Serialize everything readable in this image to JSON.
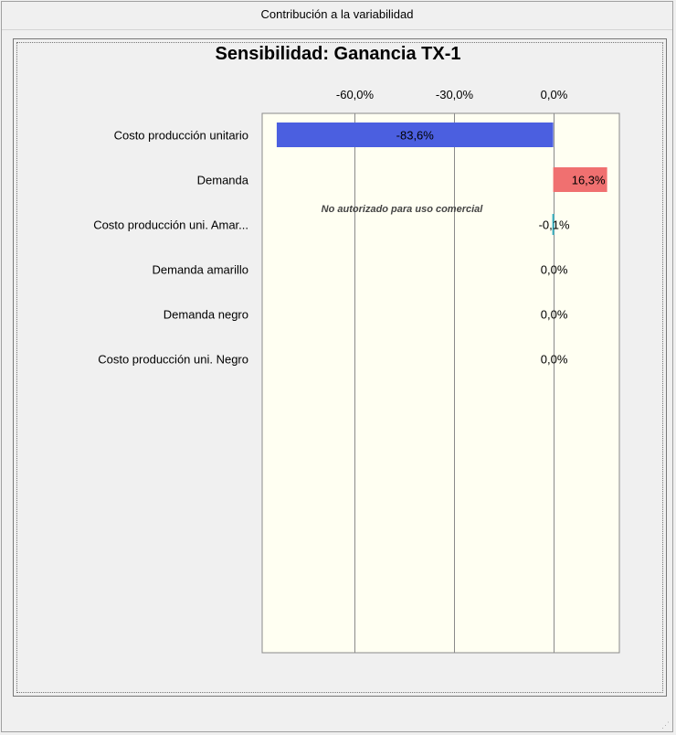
{
  "window": {
    "title": "Contribución a la variabilidad"
  },
  "chart_data": {
    "type": "bar",
    "orientation": "horizontal",
    "title": "Sensibilidad: Ganancia TX-1",
    "categories": [
      "Costo producción unitario",
      "Demanda",
      "Costo producción uni.  Amar...",
      "Demanda amarillo",
      "Demanda negro",
      "Costo producción uni. Negro"
    ],
    "values": [
      -83.6,
      16.3,
      -0.1,
      0.0,
      0.0,
      0.0
    ],
    "value_labels": [
      "-83,6%",
      "16,3%",
      "-0,1%",
      "0,0%",
      "0,0%",
      "0,0%"
    ],
    "bar_colors": [
      "#4b5fe0",
      "#f07070",
      "#3ab3c4",
      "#3ab3c4",
      "#3ab3c4",
      "#3ab3c4"
    ],
    "xlim": [
      -88,
      20
    ],
    "ticks": [
      -60,
      -30,
      0
    ],
    "tick_labels": [
      "-60,0%",
      "-30,0%",
      "0,0%"
    ],
    "tick_position": "top",
    "grid": true,
    "plot_background": "#fffff2",
    "watermark": "No autorizado para uso comercial"
  }
}
